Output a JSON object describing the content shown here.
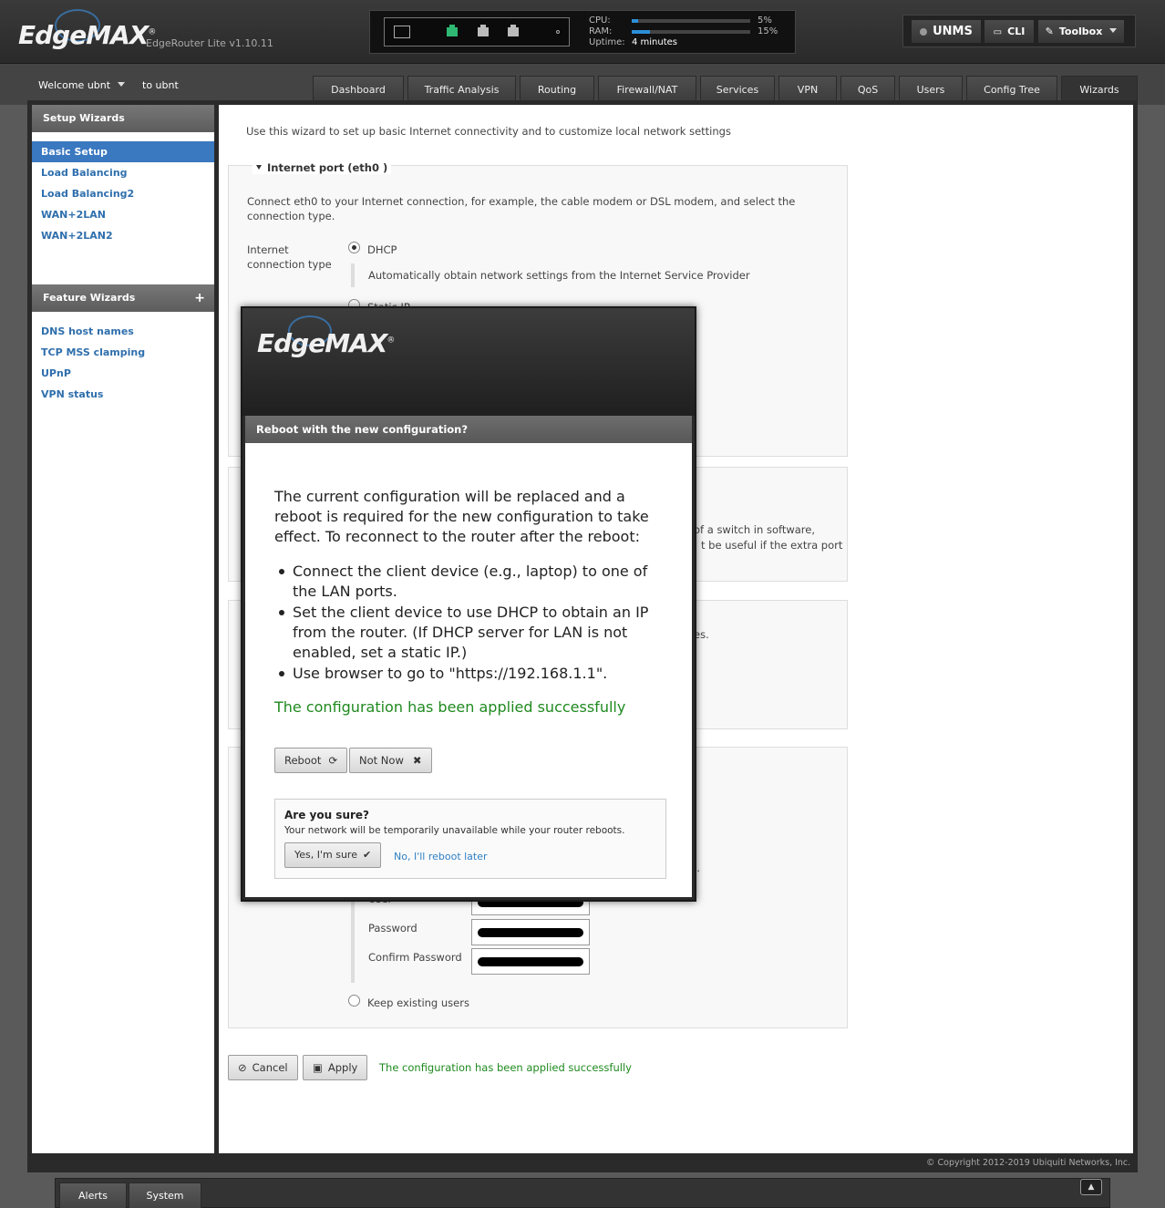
{
  "header": {
    "logo": "EdgeMAX",
    "model": "EdgeRouter Lite v1.10.11",
    "cpu_label": "CPU:",
    "cpu_pct": "5%",
    "cpu_value": 5,
    "ram_label": "RAM:",
    "ram_pct": "15%",
    "ram_value": 15,
    "uptime_label": "Uptime:",
    "uptime_value": "4 minutes",
    "unms_label": "UNMS",
    "cli_label": "CLI",
    "toolbox_label": "Toolbox"
  },
  "nav": {
    "welcome": "Welcome ubnt",
    "to_user": "to ubnt",
    "tabs": [
      "Dashboard",
      "Traffic Analysis",
      "Routing",
      "Firewall/NAT",
      "Services",
      "VPN",
      "QoS",
      "Users",
      "Config Tree",
      "Wizards"
    ],
    "active_tab": "Wizards"
  },
  "sidebar": {
    "setup_title": "Setup Wizards",
    "setup_items": [
      "Basic Setup",
      "Load Balancing",
      "Load Balancing2",
      "WAN+2LAN",
      "WAN+2LAN2"
    ],
    "feature_title": "Feature Wizards",
    "feature_plus": "+",
    "feature_items": [
      "DNS host names",
      "TCP MSS clamping",
      "UPnP",
      "VPN status"
    ]
  },
  "wizard": {
    "intro": "Use this wizard to set up basic Internet connectivity and to customize local network settings",
    "internet_legend": "Internet port (eth0 )",
    "internet_desc": "Connect eth0 to your Internet connection, for example, the cable modem or DSL modem, and select the connection type.",
    "conn_type_label": "Internet connection type",
    "dhcp_label": "DHCP",
    "dhcp_desc": "Automatically obtain network settings from the Internet Service Provider",
    "static_ip_label": "Static IP",
    "switch_text_1": "of a switch in software,",
    "switch_text_2": "t be useful if the extra port",
    "partial_text_es": "es.",
    "partial_text_l": "l.",
    "user_label": "User",
    "password_label": "Password",
    "confirm_password_label": "Confirm Password",
    "keep_users_label": "Keep existing users",
    "cancel_label": "Cancel",
    "apply_label": "Apply",
    "status": "The configuration has been applied successfully"
  },
  "footer": {
    "copyright": "© Copyright 2012-2019 Ubiquiti Networks, Inc.",
    "tabs": [
      "Alerts",
      "System"
    ]
  },
  "modal": {
    "logo": "EdgeMAX",
    "title": "Reboot with the new configuration?",
    "para": "The current configuration will be replaced and a reboot is required for the new configuration to take effect. To reconnect to the router after the reboot:",
    "bullets": [
      "Connect the client device (e.g., laptop) to one of the LAN ports.",
      "Set the client device to use DHCP to obtain an IP from the router. (If DHCP server for LAN is not enabled, set a static IP.)",
      "Use browser to go to \"https://192.168.1.1\"."
    ],
    "status": "The configuration has been applied successfully",
    "reboot_label": "Reboot",
    "not_now_label": "Not Now",
    "confirm_title": "Are you sure?",
    "confirm_sub": "Your network will be temporarily unavailable while your router reboots.",
    "yes_label": "Yes, I'm sure",
    "no_label": "No, I'll reboot later"
  },
  "colors": {
    "accent_blue": "#3a78c0",
    "link_blue": "#2f6fad",
    "success_green": "#1f8a1f",
    "port_active": "#2eb872"
  }
}
